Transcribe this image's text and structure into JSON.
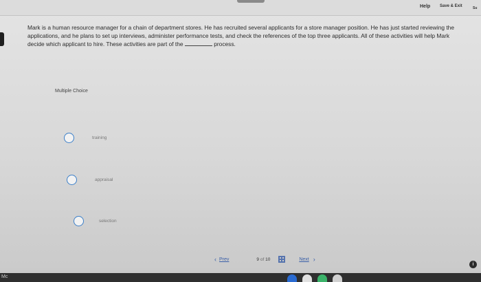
{
  "header": {
    "help_label": "Help",
    "save_exit_label": "Save & Exit",
    "submit_label": "Su"
  },
  "question": {
    "part1": "Mark is a human resource manager for a chain of department stores. He has recruited several applicants for a store manager position. He has just started reviewing the applications, and he plans to set up interviews, administer performance tests, and check the references of the top three applicants. All of these activities will help Mark decide which applicant to hire. These activities are part of the",
    "part2": "process."
  },
  "question_type": "Multiple Choice",
  "options": [
    {
      "label": "training"
    },
    {
      "label": "appraisal"
    },
    {
      "label": "selection"
    }
  ],
  "pager": {
    "prev_label": "Prev",
    "current": "9",
    "of_label": "of",
    "total": "10",
    "next_label": "Next"
  },
  "dock": {
    "label": "Mc"
  },
  "colors": {
    "radio_border": "#3b7fc9",
    "link": "#3a5fa8"
  }
}
